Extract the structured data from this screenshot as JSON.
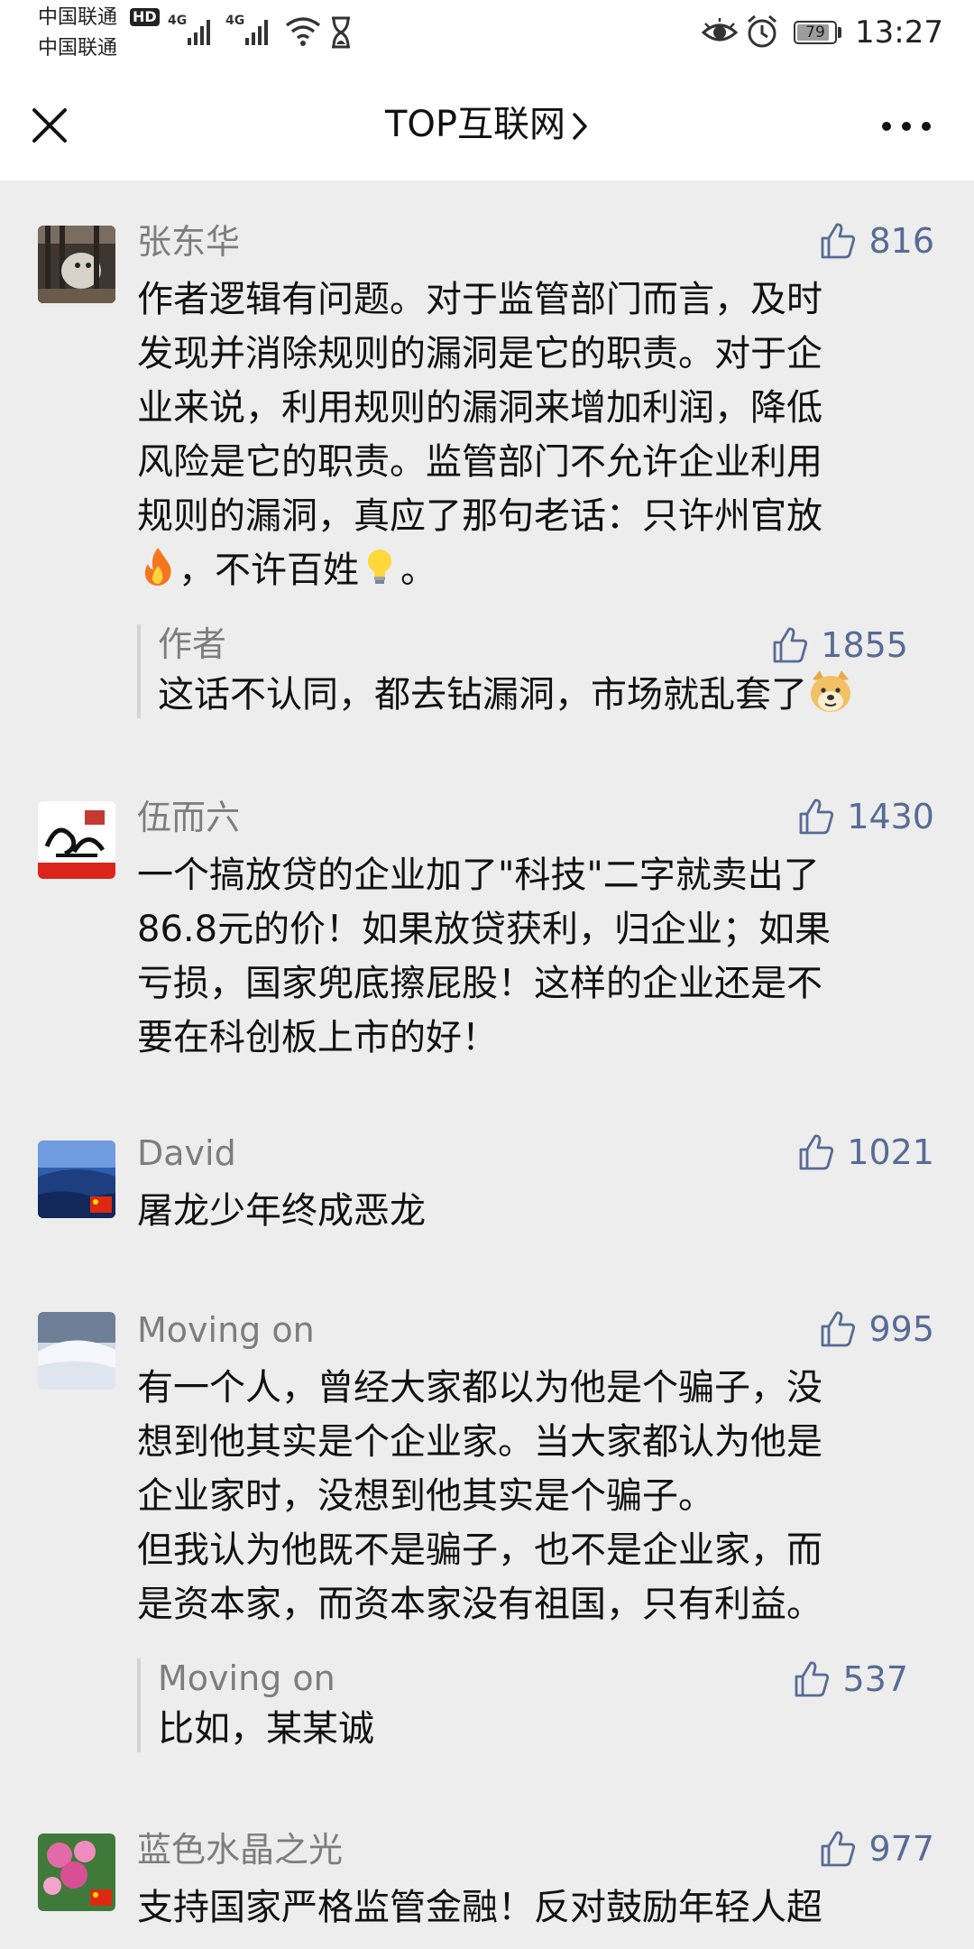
{
  "status_bar": {
    "carrier_1": "中国联通",
    "carrier_2": "中国联通",
    "hd": "HD",
    "net_1": "4G",
    "net_2": "4G",
    "battery": "79",
    "time": "13:27"
  },
  "header": {
    "title": "TOP互联网",
    "icons": [
      "close-icon",
      "chevron-right-icon",
      "more-icon"
    ]
  },
  "comments": [
    {
      "author": "张东华",
      "likes": "816",
      "lines": [
        "作者逻辑有问题。对于监管部门而言，及时",
        "发现并消除规则的漏洞是它的职责。对于企",
        "业来说，利用规则的漏洞来增加利润，降低",
        "风险是它的职责。监管部门不允许企业利用",
        "规则的漏洞，真应了那句老话：只许州官放"
      ],
      "last_line_a": "，不许百姓",
      "last_line_b": "。",
      "emoji_1": "fire-emoji",
      "emoji_2": "lightbulb-emoji",
      "reply": {
        "author": "作者",
        "likes": "1855",
        "content": "这话不认同，都去钻漏洞，市场就乱套了",
        "emoji": "doge-emoji"
      }
    },
    {
      "author": "伍而六",
      "likes": "1430",
      "lines": [
        "一个搞放贷的企业加了\"科技\"二字就卖出了",
        "86.8元的价！如果放贷获利，归企业；如果",
        "亏损，国家兜底擦屁股！这样的企业还是不",
        "要在科创板上市的好！"
      ]
    },
    {
      "author": "David",
      "likes": "1021",
      "lines": [
        "屠龙少年终成恶龙"
      ]
    },
    {
      "author": "Moving on",
      "likes": "995",
      "lines": [
        "有一个人，曾经大家都以为他是个骗子，没",
        "想到他其实是个企业家。当大家都认为他是",
        "企业家时，没想到他其实是个骗子。",
        "但我认为他既不是骗子，也不是企业家，而",
        "是资本家，而资本家没有祖国，只有利益。"
      ],
      "reply": {
        "author": "Moving on",
        "likes": "537",
        "content": "比如，某某诚"
      }
    },
    {
      "author": "蓝色水晶之光",
      "likes": "977",
      "lines": [
        "支持国家严格监管金融！反对鼓励年轻人超"
      ]
    }
  ],
  "colors": {
    "background": "#ededed",
    "link_blue": "#576b95",
    "author_gray": "#7d7d7d"
  }
}
